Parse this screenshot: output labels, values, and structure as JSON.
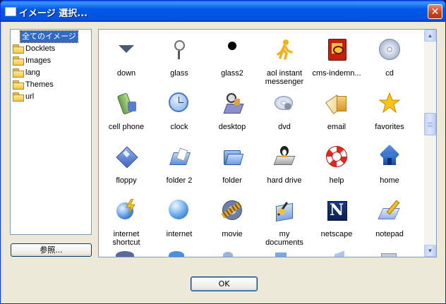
{
  "window": {
    "title": "イメージ 選択...",
    "close_glyph": "✕"
  },
  "tree": {
    "root_label": "全てのイメージ",
    "folders": [
      "Docklets",
      "Images",
      "lang",
      "Themes",
      "url"
    ]
  },
  "buttons": {
    "browse": "参照...",
    "ok": "OK"
  },
  "grid": {
    "items": [
      {
        "label": "down",
        "icon": "down-arrow-icon"
      },
      {
        "label": "glass",
        "icon": "magnifier-icon"
      },
      {
        "label": "glass2",
        "icon": "black-dot-icon"
      },
      {
        "label": "aol instant messenger",
        "line1": "aol instant",
        "line2": "messenger",
        "icon": "aim-runner-icon"
      },
      {
        "label": "cms-indemn...",
        "icon": "book-icon"
      },
      {
        "label": "cd",
        "icon": "cd-icon"
      },
      {
        "label": "cell phone",
        "icon": "cell-phone-icon"
      },
      {
        "label": "clock",
        "icon": "clock-icon"
      },
      {
        "label": "desktop",
        "icon": "desktop-icon"
      },
      {
        "label": "dvd",
        "icon": "dvd-icon"
      },
      {
        "label": "email",
        "icon": "email-icon"
      },
      {
        "label": "favorites",
        "icon": "star-icon"
      },
      {
        "label": "floppy",
        "icon": "floppy-icon"
      },
      {
        "label": "folder 2",
        "icon": "folder-open-icon"
      },
      {
        "label": "folder",
        "icon": "folder-blue-icon"
      },
      {
        "label": "hard drive",
        "icon": "hard-drive-icon"
      },
      {
        "label": "help",
        "icon": "lifebuoy-icon"
      },
      {
        "label": "home",
        "icon": "home-icon"
      },
      {
        "label": "internet shortcut",
        "line1": "internet",
        "line2": "shortcut",
        "icon": "internet-shortcut-icon"
      },
      {
        "label": "internet",
        "icon": "globe-icon"
      },
      {
        "label": "movie",
        "icon": "film-reel-icon"
      },
      {
        "label": "my documents",
        "line1": "my",
        "line2": "documents",
        "icon": "my-documents-icon"
      },
      {
        "label": "netscape",
        "icon": "netscape-icon"
      },
      {
        "label": "notepad",
        "icon": "notepad-icon"
      }
    ]
  },
  "colors": {
    "titlebar": "#0058E6",
    "selection": "#316AC5",
    "window_bg": "#ECE9D8"
  }
}
